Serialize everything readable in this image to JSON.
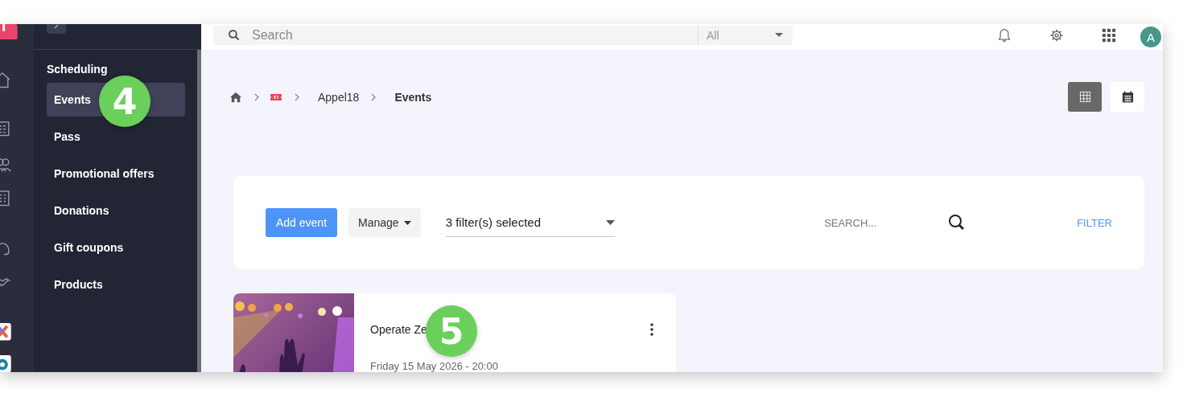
{
  "sidebar": {
    "section": "Scheduling",
    "items": [
      {
        "label": "Events",
        "selected": true
      },
      {
        "label": "Pass",
        "selected": false
      },
      {
        "label": "Promotional offers",
        "selected": false
      },
      {
        "label": "Donations",
        "selected": false
      },
      {
        "label": "Gift coupons",
        "selected": false
      },
      {
        "label": "Products",
        "selected": false
      }
    ]
  },
  "topbar": {
    "search": {
      "placeholder": "Search"
    },
    "scope": "All",
    "avatar": "A"
  },
  "breadcrumb": [
    {
      "kind": "home"
    },
    {
      "kind": "ticket"
    },
    {
      "kind": "text",
      "label": "Appel18"
    },
    {
      "kind": "current",
      "label": "Events"
    }
  ],
  "views": [
    {
      "kind": "grid",
      "selected": true
    },
    {
      "kind": "calendar",
      "selected": false
    }
  ],
  "toolbar": {
    "add_button": "Add event",
    "manage_button": "Manage",
    "filter_select": "3 filter(s) selected",
    "search": {
      "placeholder": "SEARCH..."
    },
    "filter_link": "FILTER"
  },
  "events": [
    {
      "title": "Operate Ze",
      "date": "Friday 15 May 2026 - 20:00"
    }
  ],
  "callouts": [
    "4",
    "5"
  ]
}
